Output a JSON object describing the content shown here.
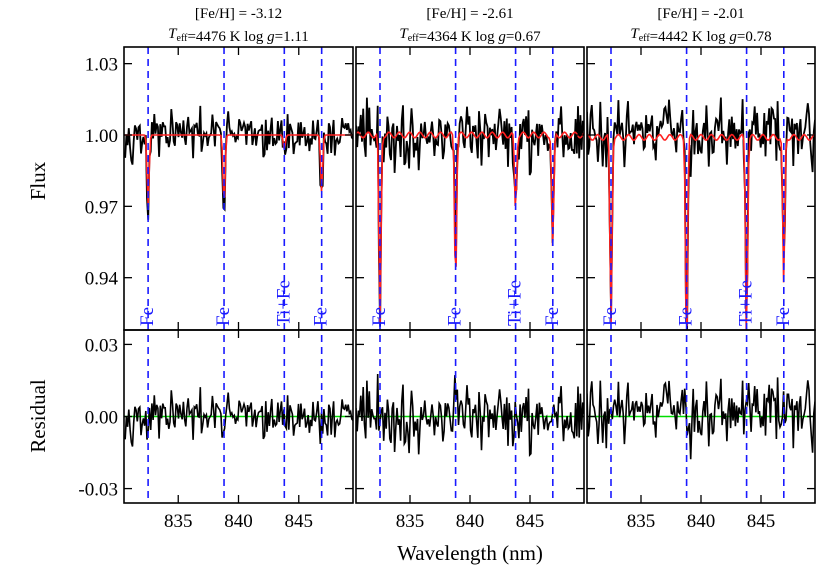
{
  "chart_data": {
    "type": "line",
    "xlabel": "Wavelength (nm)",
    "xlim": [
      830.5,
      849.5
    ],
    "xticks": [
      835,
      840,
      845
    ],
    "flux_panel": {
      "ylabel": "Flux",
      "ylim": [
        0.918,
        1.037
      ],
      "yticks": [
        0.94,
        0.97,
        1.0,
        1.03
      ],
      "ytick_labels": [
        "0.94",
        "0.97",
        "1.00",
        "1.03"
      ]
    },
    "residual_panel": {
      "ylabel": "Residual",
      "ylim": [
        -0.036,
        0.036
      ],
      "yticks": [
        -0.03,
        0.0,
        0.03
      ],
      "ytick_labels": [
        "-0.03",
        "0.00",
        "0.03"
      ],
      "zero_line_color": "#00dd00"
    },
    "line_markers": [
      {
        "wavelength": 832.5,
        "label": "Fe"
      },
      {
        "wavelength": 838.8,
        "label": "Fe"
      },
      {
        "wavelength": 843.8,
        "label": "Ti+Fe"
      },
      {
        "wavelength": 846.9,
        "label": "Fe"
      }
    ],
    "colors": {
      "observed": "#000000",
      "model": "#ff2020",
      "markers": "#1a1aff",
      "residual_zero": "#00dd00"
    },
    "stars": [
      {
        "title_line1": "[Fe/H] = -3.12",
        "teff_sym": "T",
        "teff_sub": "eff",
        "teff_val": "=4476 K",
        "logg_pre": "log ",
        "logg_sym": "g",
        "logg_val": "=1.11",
        "line_depths_obs": [
          0.036,
          0.036,
          0.006,
          0.028
        ],
        "line_depths_model": [
          0.03,
          0.03,
          0.006,
          0.024
        ],
        "noise": 0.0085
      },
      {
        "title_line1": "[Fe/H] = -2.61",
        "teff_sym": "T",
        "teff_sub": "eff",
        "teff_val": "=4364 K",
        "logg_pre": "log ",
        "logg_sym": "g",
        "logg_val": "=0.67",
        "line_depths_obs": [
          0.082,
          0.064,
          0.03,
          0.05
        ],
        "line_depths_model": [
          0.08,
          0.062,
          0.032,
          0.048
        ],
        "noise": 0.013
      },
      {
        "title_line1": "[Fe/H] = -2.01",
        "teff_sym": "T",
        "teff_sub": "eff",
        "teff_val": "=4442 K",
        "logg_pre": "log ",
        "logg_sym": "g",
        "logg_val": "=0.78",
        "line_depths_obs": [
          0.078,
          0.09,
          0.085,
          0.064
        ],
        "line_depths_model": [
          0.078,
          0.09,
          0.085,
          0.063
        ],
        "noise": 0.013
      }
    ]
  }
}
